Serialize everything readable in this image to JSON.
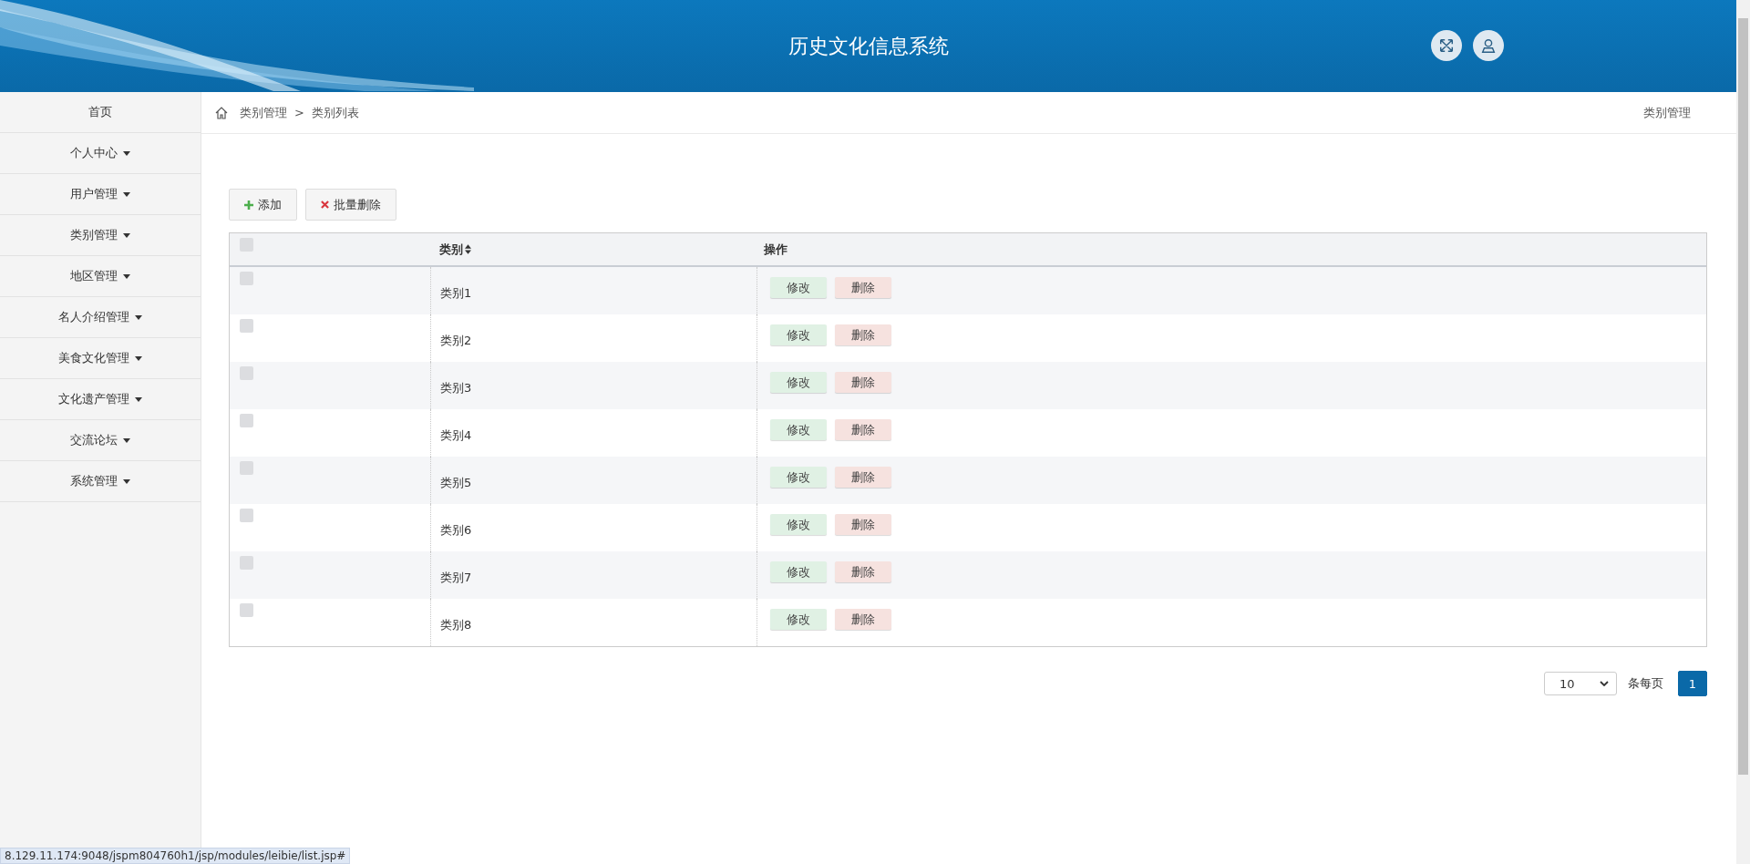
{
  "header": {
    "title": "历史文化信息系统"
  },
  "sidebar": {
    "items": [
      {
        "label": "首页",
        "has_menu": false
      },
      {
        "label": "个人中心",
        "has_menu": true
      },
      {
        "label": "用户管理",
        "has_menu": true
      },
      {
        "label": "类别管理",
        "has_menu": true
      },
      {
        "label": "地区管理",
        "has_menu": true
      },
      {
        "label": "名人介绍管理",
        "has_menu": true
      },
      {
        "label": "美食文化管理",
        "has_menu": true
      },
      {
        "label": "文化遗产管理",
        "has_menu": true
      },
      {
        "label": "交流论坛",
        "has_menu": true
      },
      {
        "label": "系统管理",
        "has_menu": true
      }
    ]
  },
  "breadcrumb": {
    "items": [
      "类别管理",
      "类别列表"
    ],
    "separator": ">",
    "page_title": "类别管理"
  },
  "toolbar": {
    "buttons": [
      {
        "label": "添加",
        "kind": "add"
      },
      {
        "label": "批量删除",
        "kind": "delete"
      }
    ]
  },
  "table": {
    "select_all": {
      "checked": false
    },
    "columns": [
      "类别",
      "操作"
    ],
    "rows": [
      {
        "checked": false,
        "category": "类别1",
        "actions": [
          "修改",
          "删除"
        ]
      },
      {
        "checked": false,
        "category": "类别2",
        "actions": [
          "修改",
          "删除"
        ]
      },
      {
        "checked": false,
        "category": "类别3",
        "actions": [
          "修改",
          "删除"
        ]
      },
      {
        "checked": false,
        "category": "类别4",
        "actions": [
          "修改",
          "删除"
        ]
      },
      {
        "checked": false,
        "category": "类别5",
        "actions": [
          "修改",
          "删除"
        ]
      },
      {
        "checked": false,
        "category": "类别6",
        "actions": [
          "修改",
          "删除"
        ]
      },
      {
        "checked": false,
        "category": "类别7",
        "actions": [
          "修改",
          "删除"
        ]
      },
      {
        "checked": false,
        "category": "类别8",
        "actions": [
          "修改",
          "删除"
        ]
      }
    ]
  },
  "pagination": {
    "page_size": "10",
    "per_page_label": "条每页",
    "pages": [
      {
        "label": "1",
        "selected": true
      }
    ]
  },
  "status_url": "8.129.11.174:9048/jspm804760h1/jsp/modules/leibie/list.jsp#"
}
